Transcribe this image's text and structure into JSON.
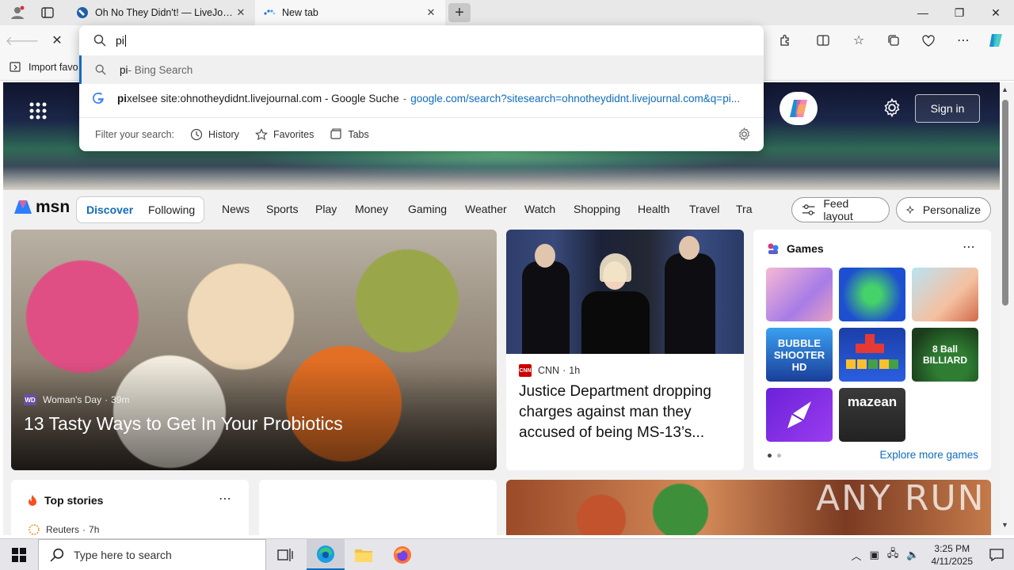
{
  "tabs": [
    {
      "title": "Oh No They Didn't! — LiveJournal",
      "active": false
    },
    {
      "title": "New tab",
      "active": true
    }
  ],
  "omnibox": {
    "query": "pi",
    "suggestions": [
      {
        "bold": "pi",
        "rest": " - Bing Search",
        "url": ""
      },
      {
        "bold": "pi",
        "rest": "xelsee site:ohnotheydidnt.livejournal.com - Google Suche",
        "url": "google.com/search?sitesearch=ohnotheydidnt.livejournal.com&q=pi..."
      }
    ],
    "filter_label": "Filter your search:",
    "filters": [
      "History",
      "Favorites",
      "Tabs"
    ]
  },
  "favorites_bar": {
    "label": "Import favo"
  },
  "msn": {
    "sign_in": "Sign in",
    "logo_text": "msn",
    "pill": [
      "Discover",
      "Following"
    ],
    "nav": [
      "News",
      "Sports",
      "Play",
      "Money",
      "Gaming",
      "Weather",
      "Watch",
      "Shopping",
      "Health",
      "Travel",
      "Tra"
    ],
    "feed_layout": "Feed layout",
    "personalize": "Personalize",
    "main_story": {
      "source": "Woman's Day",
      "time": "39m",
      "logo": "WD",
      "headline": "13 Tasty Ways to Get In Your Probiotics"
    },
    "news_story": {
      "source": "CNN",
      "time": "1h",
      "logo": "CNN",
      "headline": "Justice Department dropping charges against man they accused of being MS-13’s..."
    },
    "games": {
      "title": "Games",
      "tiles": [
        "",
        "",
        "",
        "BUBBLE SHOOTER HD",
        "",
        "8 Ball BILLIARD",
        "",
        "mazean"
      ],
      "explore": "Explore more games"
    },
    "top_stories": {
      "title": "Top stories",
      "source": "Reuters",
      "time": "7h"
    }
  },
  "watermark": "ANY RUN",
  "taskbar": {
    "search_placeholder": "Type here to search",
    "time": "3:25 PM",
    "date": "4/11/2025"
  },
  "colors": {
    "accent": "#0f6cbd",
    "titlebar": "#e8e8e8",
    "cnn_red": "#cc0000"
  }
}
